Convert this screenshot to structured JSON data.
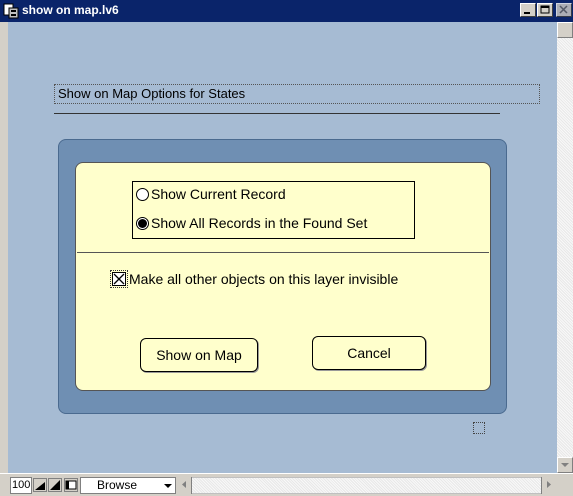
{
  "window": {
    "title": "show on map.lv6"
  },
  "layout": {
    "header_label": "Show on Map Options for States",
    "radio_options": [
      {
        "label": "Show Current Record",
        "selected": false
      },
      {
        "label": "Show All Records in the Found Set",
        "selected": true
      }
    ],
    "checkbox": {
      "label": "Make all other objects on this layer invisible",
      "checked": true
    },
    "buttons": {
      "show_on_map": "Show on Map",
      "cancel": "Cancel"
    }
  },
  "statusbar": {
    "zoom": "100",
    "mode": "Browse"
  },
  "icons": {
    "title": "app-icon",
    "minimize": "minimize-icon",
    "maximize": "maximize-icon",
    "close": "close-icon"
  },
  "colors": {
    "titlebar": "#0a246a",
    "content_bg": "#a6bbd3",
    "outer_panel": "#6f8fb3",
    "inner_panel": "#ffffcc"
  }
}
